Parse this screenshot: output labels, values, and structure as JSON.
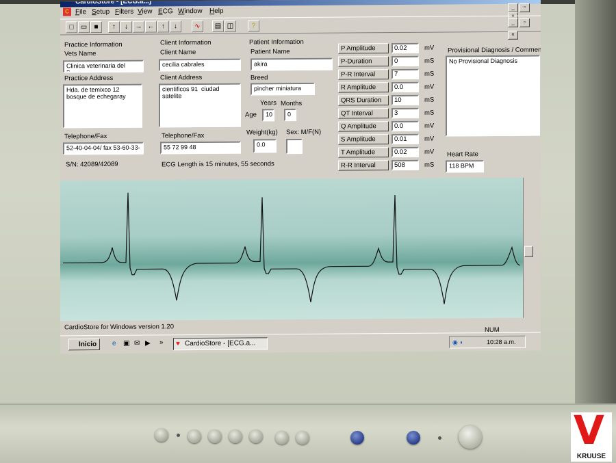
{
  "window": {
    "title": "CardioStore - [ECG.a...]",
    "menu": [
      "File",
      "Setup",
      "Filters",
      "View",
      "ECG",
      "Window",
      "Help"
    ]
  },
  "practice": {
    "section": "Practice Information",
    "vets_name_label": "Vets Name",
    "vets_name": "Clinica veterinaria del Bosq",
    "address_label": "Practice Address",
    "address": "Hda. de temixco 12\nbosque de echegaray",
    "phone_label": "Telephone/Fax",
    "phone": "52-40-04-04/ fax 53-60-33-",
    "serial": "S/N:  42089/42089"
  },
  "client": {
    "section": "Client Information",
    "name_label": "Client Name",
    "name": "cecilia cabrales",
    "address_label": "Client Address",
    "address": "cientificos 91  ciudad\nsatelite",
    "phone_label": "Telephone/Fax",
    "phone": "55 72 99 48",
    "ecg_length": "ECG Length is 15 minutes, 55 seconds"
  },
  "patient": {
    "section": "Patient Information",
    "name_label": "Patient Name",
    "name": "akira",
    "breed_label": "Breed",
    "breed": "pincher miniatura",
    "years_label": "Years",
    "months_label": "Months",
    "age_label": "Age",
    "age_years": "10",
    "age_months": "0",
    "weight_label": "Weight(kg)",
    "weight": "0.0",
    "sex_label": "Sex: M/F(N)",
    "sex": ""
  },
  "params": [
    {
      "label": "P Amplitude",
      "value": "0.02",
      "unit": "mV"
    },
    {
      "label": "P-Duration",
      "value": "0",
      "unit": "mS"
    },
    {
      "label": "P-R Interval",
      "value": "7",
      "unit": "mS"
    },
    {
      "label": "R Amplitude",
      "value": "0.0",
      "unit": "mV"
    },
    {
      "label": "QRS Duration",
      "value": "10",
      "unit": "mS"
    },
    {
      "label": "QT Interval",
      "value": "3",
      "unit": "mS"
    },
    {
      "label": "Q Amplitude",
      "value": "0.0",
      "unit": "mV"
    },
    {
      "label": "S Amplitude",
      "value": "0.01",
      "unit": "mV"
    },
    {
      "label": "T Amplitude",
      "value": "0.02",
      "unit": "mV"
    },
    {
      "label": "R-R Interval",
      "value": "508",
      "unit": "mS"
    }
  ],
  "diagnosis": {
    "label": "Provisional Diagnosis / Comment",
    "text": "No Provisional Diagnosis",
    "hr_label": "Heart Rate",
    "hr": "118 BPM"
  },
  "status": {
    "version": "CardioStore for Windows version 1.20",
    "num": "NUM"
  },
  "taskbar": {
    "start": "Inicio",
    "task": "CardioStore - [ECG.a...",
    "clock": "10:28 a.m."
  },
  "brand": {
    "logo_letter": "V",
    "logo_text": "KRUUSE",
    "logo_color": "#e01818"
  }
}
